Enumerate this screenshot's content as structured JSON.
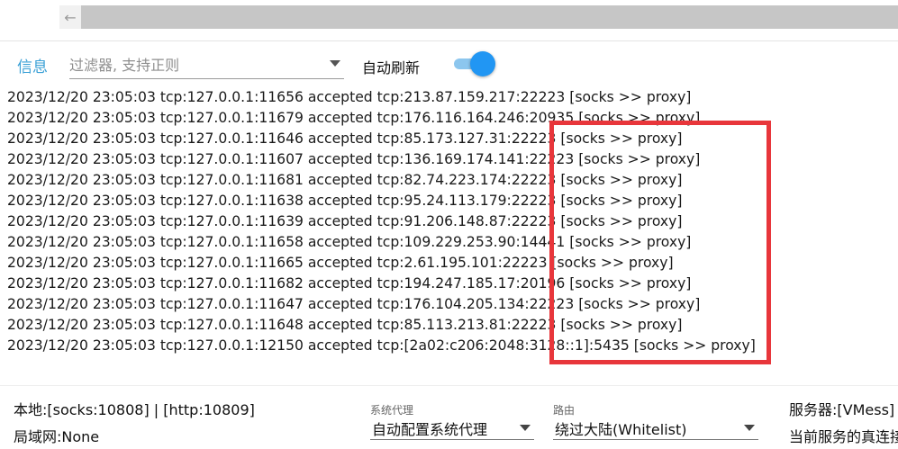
{
  "toolbar": {
    "tab_label": "信息",
    "filter_placeholder": "过滤器, 支持正则",
    "auto_refresh_label": "自动刷新",
    "auto_refresh_on": true
  },
  "log": [
    "2023/12/20 23:05:03 tcp:127.0.0.1:11656 accepted tcp:213.87.159.217:22223 [socks >> proxy]",
    "2023/12/20 23:05:03 tcp:127.0.0.1:11679 accepted tcp:176.116.164.246:20935 [socks >> proxy]",
    "2023/12/20 23:05:03 tcp:127.0.0.1:11646 accepted tcp:85.173.127.31:22223 [socks >> proxy]",
    "2023/12/20 23:05:03 tcp:127.0.0.1:11607 accepted tcp:136.169.174.141:22223 [socks >> proxy]",
    "2023/12/20 23:05:03 tcp:127.0.0.1:11681 accepted tcp:82.74.223.174:22223 [socks >> proxy]",
    "2023/12/20 23:05:03 tcp:127.0.0.1:11638 accepted tcp:95.24.113.179:22223 [socks >> proxy]",
    "2023/12/20 23:05:03 tcp:127.0.0.1:11639 accepted tcp:91.206.148.87:22223 [socks >> proxy]",
    "2023/12/20 23:05:03 tcp:127.0.0.1:11658 accepted tcp:109.229.253.90:14441 [socks >> proxy]",
    "2023/12/20 23:05:03 tcp:127.0.0.1:11665 accepted tcp:2.61.195.101:22223 [socks >> proxy]",
    "2023/12/20 23:05:03 tcp:127.0.0.1:11682 accepted tcp:194.247.185.17:20196 [socks >> proxy]",
    "2023/12/20 23:05:03 tcp:127.0.0.1:11647 accepted tcp:176.104.205.134:22223 [socks >> proxy]",
    "2023/12/20 23:05:03 tcp:127.0.0.1:11648 accepted tcp:85.113.213.81:22223 [socks >> proxy]",
    "2023/12/20 23:05:03 tcp:127.0.0.1:12150 accepted tcp:[2a02:c206:2048:3128::1]:5435 [socks >> proxy]"
  ],
  "status": {
    "local_ports": "本地:[socks:10808] | [http:10809]",
    "lan": "局域网:None",
    "system_proxy_caption": "系统代理",
    "system_proxy_value": "自动配置系统代理",
    "routing_caption": "路由",
    "routing_value": "绕过大陆(Whitelist)",
    "server": "服务器:[VMess]",
    "current_service": "当前服务的真连接延迟"
  },
  "colors": {
    "accent": "#2196f3",
    "tab_text": "#3aa0d6",
    "highlight_border": "#e8363b"
  }
}
